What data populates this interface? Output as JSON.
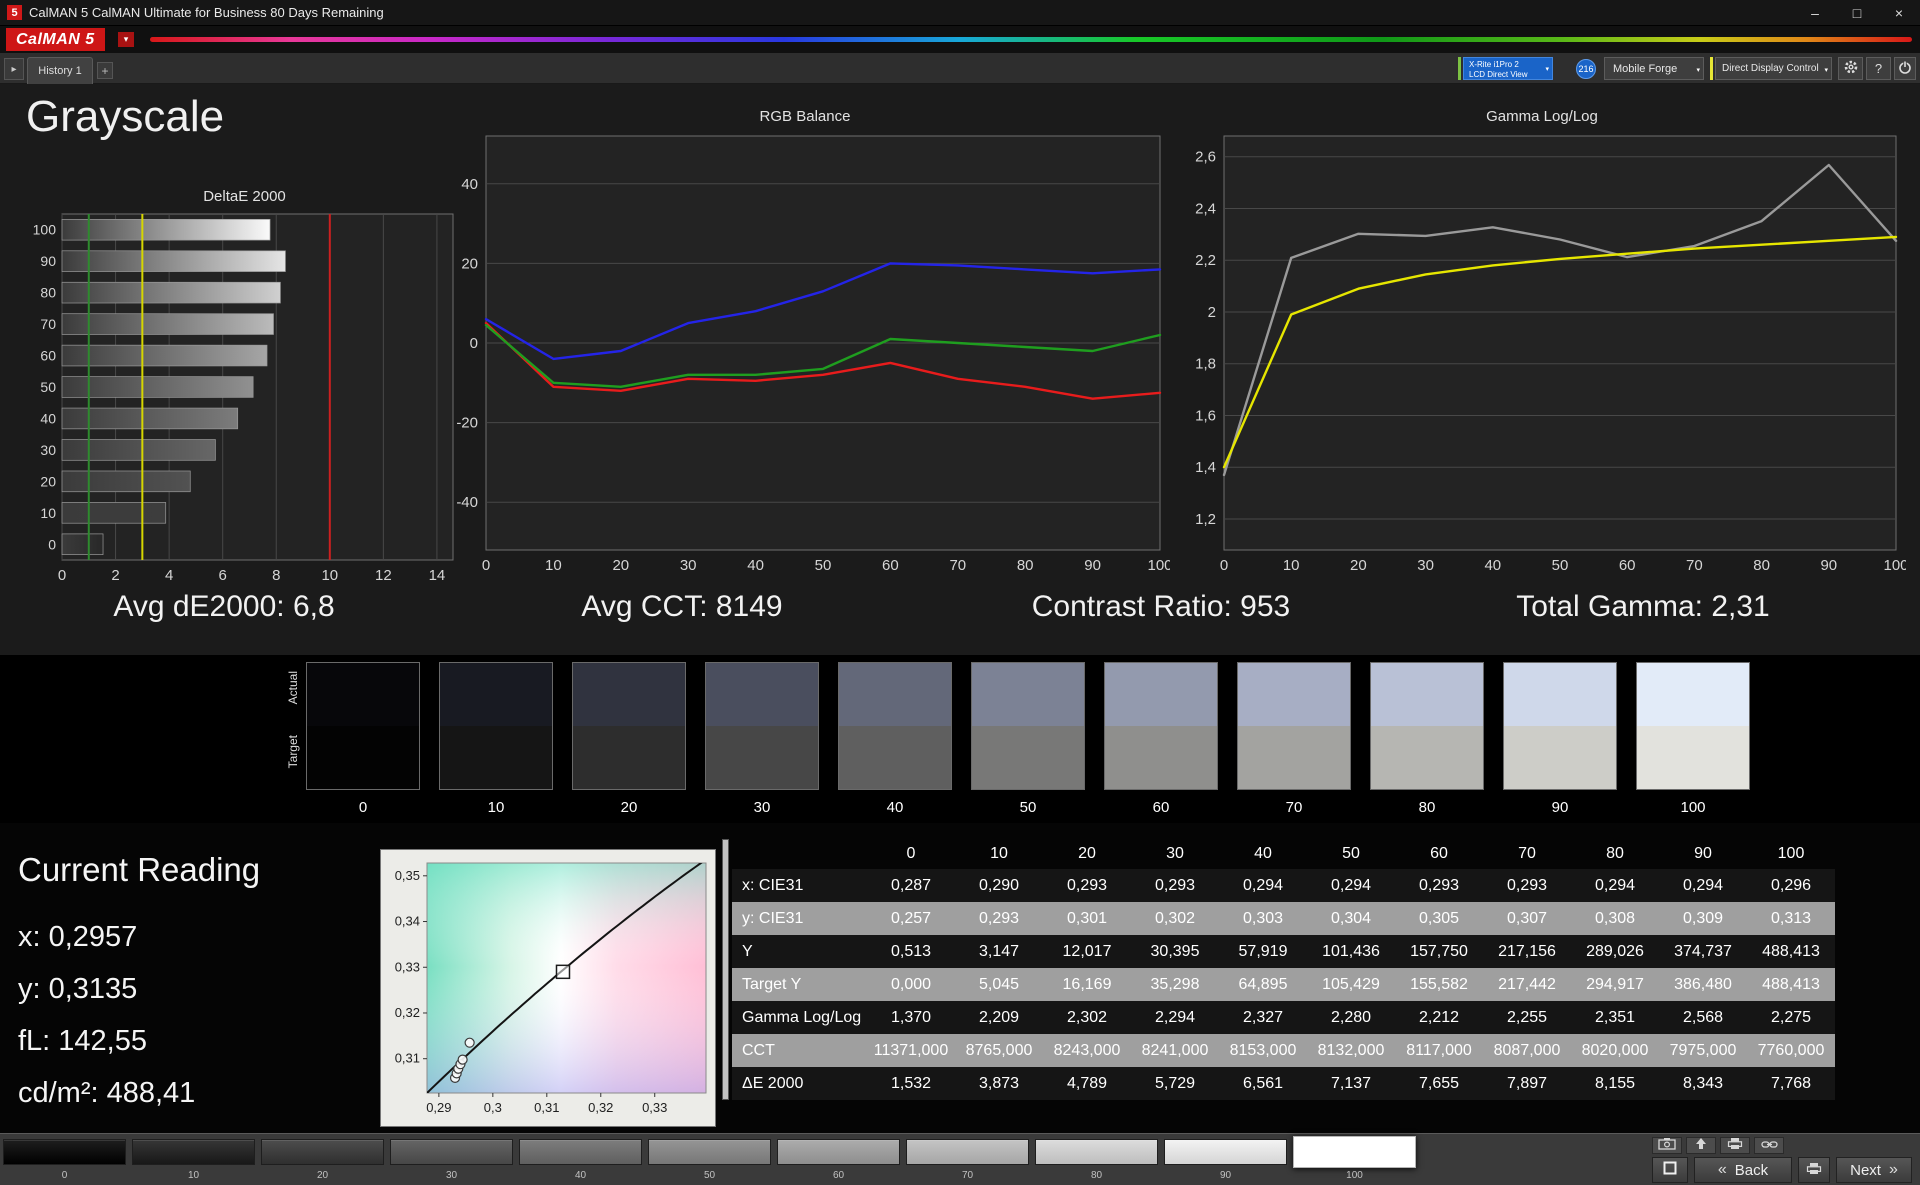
{
  "window": {
    "icon_text": "5",
    "title": "CalMAN 5 CalMAN Ultimate for Business 80 Days Remaining",
    "minimize": "–",
    "maximize": "□",
    "close": "×"
  },
  "brand": {
    "logo": "CalMAN 5"
  },
  "glyphs": {
    "caret_down": "▾",
    "tab_arrow": "▸",
    "plus": "+"
  },
  "toolbar": {
    "history_tab": "History 1",
    "meter_line1": "X-Rite i1Pro 2",
    "meter_line2": "LCD Direct View",
    "meter_badge": "216",
    "source_button": "Mobile Forge",
    "display_button": "Direct Display Control",
    "help_label": "?"
  },
  "page_title": "Grayscale",
  "stats": {
    "de2000": "Avg dE2000: 6,8",
    "cct": "Avg CCT: 8149",
    "contrast": "Contrast Ratio: 953",
    "gamma": "Total Gamma: 2,31"
  },
  "chart_data": [
    {
      "id": "deltae",
      "type": "bar",
      "title": "DeltaE 2000",
      "orientation": "horizontal",
      "categories": [
        "100",
        "90",
        "80",
        "70",
        "60",
        "50",
        "40",
        "30",
        "20",
        "10",
        "0"
      ],
      "values": [
        7.768,
        8.343,
        8.155,
        7.897,
        7.655,
        7.137,
        6.561,
        5.729,
        4.789,
        3.873,
        1.532
      ],
      "xlim": [
        0,
        14.6
      ],
      "xticks": [
        0,
        2,
        4,
        6,
        8,
        10,
        12,
        14
      ],
      "reference_lines": [
        {
          "x": 1,
          "color": "#2e8b2e",
          "name": "target-line"
        },
        {
          "x": 3,
          "color": "#d6d600",
          "name": "tolerance-line"
        },
        {
          "x": 10,
          "color": "#cc2020",
          "name": "limit-line"
        }
      ]
    },
    {
      "id": "rgb-balance",
      "type": "line",
      "title": "RGB Balance",
      "x": [
        0,
        10,
        20,
        30,
        40,
        50,
        60,
        70,
        80,
        90,
        100
      ],
      "xticks": [
        0,
        10,
        20,
        30,
        40,
        50,
        60,
        70,
        80,
        90,
        100
      ],
      "ylim": [
        -52,
        52
      ],
      "yticks": [
        {
          "v": 40,
          "label": "40"
        },
        {
          "v": 20,
          "label": "20"
        },
        {
          "v": 0,
          "label": "0"
        },
        {
          "v": -20,
          "label": "-20"
        },
        {
          "v": -40,
          "label": "-40"
        }
      ],
      "series": [
        {
          "name": "Red",
          "color": "#e81c1c",
          "values": [
            5,
            -11,
            -12,
            -9,
            -9.5,
            -8,
            -5,
            -9,
            -11,
            -14,
            -12.5
          ]
        },
        {
          "name": "Green",
          "color": "#1f9e1f",
          "values": [
            4.5,
            -10,
            -11,
            -8,
            -8,
            -6.5,
            1,
            0,
            -1,
            -2,
            2
          ]
        },
        {
          "name": "Blue",
          "color": "#2424e8",
          "values": [
            6,
            -4,
            -2,
            5,
            8,
            13,
            20,
            19.5,
            18.5,
            17.5,
            18.5
          ]
        }
      ]
    },
    {
      "id": "gamma",
      "type": "line",
      "title": "Gamma Log/Log",
      "x": [
        0,
        10,
        20,
        30,
        40,
        50,
        60,
        70,
        80,
        90,
        100
      ],
      "xticks": [
        0,
        10,
        20,
        30,
        40,
        50,
        60,
        70,
        80,
        90,
        100
      ],
      "ylim": [
        1.08,
        2.68
      ],
      "yticks": [
        {
          "v": 2.6,
          "label": "2,6"
        },
        {
          "v": 2.4,
          "label": "2,4"
        },
        {
          "v": 2.2,
          "label": "2,2"
        },
        {
          "v": 2.0,
          "label": "2"
        },
        {
          "v": 1.8,
          "label": "1,8"
        },
        {
          "v": 1.6,
          "label": "1,6"
        },
        {
          "v": 1.4,
          "label": "1,4"
        },
        {
          "v": 1.2,
          "label": "1,2"
        }
      ],
      "series": [
        {
          "name": "Measured",
          "color": "#9a9a9a",
          "values": [
            1.37,
            2.209,
            2.302,
            2.294,
            2.327,
            2.28,
            2.212,
            2.255,
            2.351,
            2.568,
            2.275
          ]
        },
        {
          "name": "Target",
          "color": "#e6e600",
          "values": [
            1.4,
            1.99,
            2.09,
            2.145,
            2.18,
            2.205,
            2.225,
            2.245,
            2.26,
            2.275,
            2.29
          ]
        }
      ]
    },
    {
      "id": "cie",
      "type": "scatter",
      "title": "CIE xy chromaticity",
      "xlim": [
        0.2878,
        0.3395
      ],
      "ylim": [
        0.3025,
        0.3528
      ],
      "xticks": [
        {
          "v": 0.29,
          "label": "0,29"
        },
        {
          "v": 0.3,
          "label": "0,3"
        },
        {
          "v": 0.31,
          "label": "0,31"
        },
        {
          "v": 0.32,
          "label": "0,32"
        },
        {
          "v": 0.33,
          "label": "0,33"
        }
      ],
      "yticks": [
        {
          "v": 0.35,
          "label": "0,35"
        },
        {
          "v": 0.34,
          "label": "0,34"
        },
        {
          "v": 0.33,
          "label": "0,33"
        },
        {
          "v": 0.32,
          "label": "0,32"
        },
        {
          "v": 0.31,
          "label": "0,31"
        }
      ],
      "target_point": {
        "x": 0.313,
        "y": 0.329
      },
      "points": [
        {
          "x": 0.293,
          "y": 0.3058
        },
        {
          "x": 0.2933,
          "y": 0.3068
        },
        {
          "x": 0.2936,
          "y": 0.3078
        },
        {
          "x": 0.294,
          "y": 0.3088
        },
        {
          "x": 0.2944,
          "y": 0.3098
        },
        {
          "x": 0.2957,
          "y": 0.3135
        }
      ]
    }
  ],
  "swatch_strip": {
    "row_labels": [
      "Actual",
      "Target"
    ],
    "steps": [
      {
        "label": "0",
        "actual": "#07070a",
        "target": "#030303"
      },
      {
        "label": "10",
        "actual": "#181a22",
        "target": "#151515"
      },
      {
        "label": "20",
        "actual": "#30333f",
        "target": "#2d2d2d"
      },
      {
        "label": "30",
        "actual": "#4a4e5e",
        "target": "#474747"
      },
      {
        "label": "40",
        "actual": "#636879",
        "target": "#5f5f5f"
      },
      {
        "label": "50",
        "actual": "#7c8295",
        "target": "#787877"
      },
      {
        "label": "60",
        "actual": "#939aae",
        "target": "#8f8f8d"
      },
      {
        "label": "70",
        "actual": "#a7aec4",
        "target": "#a3a3a0"
      },
      {
        "label": "80",
        "actual": "#b9c1d6",
        "target": "#b6b6b2"
      },
      {
        "label": "90",
        "actual": "#cfd8ea",
        "target": "#cdcdc8"
      },
      {
        "label": "100",
        "actual": "#e2ebf8",
        "target": "#e2e2dd"
      }
    ]
  },
  "current_reading": {
    "title": "Current Reading",
    "x": "x: 0,2957",
    "y": "y: 0,3135",
    "fl": "fL: 142,55",
    "cdm2": "cd/m²: 488,41"
  },
  "table": {
    "columns": [
      "0",
      "10",
      "20",
      "30",
      "40",
      "50",
      "60",
      "70",
      "80",
      "90",
      "100"
    ],
    "rows": [
      {
        "label": "x: CIE31",
        "values": [
          "0,287",
          "0,290",
          "0,293",
          "0,293",
          "0,294",
          "0,294",
          "0,293",
          "0,293",
          "0,294",
          "0,294",
          "0,296"
        ]
      },
      {
        "label": "y: CIE31",
        "values": [
          "0,257",
          "0,293",
          "0,301",
          "0,302",
          "0,303",
          "0,304",
          "0,305",
          "0,307",
          "0,308",
          "0,309",
          "0,313"
        ]
      },
      {
        "label": "Y",
        "values": [
          "0,513",
          "3,147",
          "12,017",
          "30,395",
          "57,919",
          "101,436",
          "157,750",
          "217,156",
          "289,026",
          "374,737",
          "488,413"
        ]
      },
      {
        "label": "Target Y",
        "values": [
          "0,000",
          "5,045",
          "16,169",
          "35,298",
          "64,895",
          "105,429",
          "155,582",
          "217,442",
          "294,917",
          "386,480",
          "488,413"
        ]
      },
      {
        "label": "Gamma Log/Log",
        "values": [
          "1,370",
          "2,209",
          "2,302",
          "2,294",
          "2,327",
          "2,280",
          "2,212",
          "2,255",
          "2,351",
          "2,568",
          "2,275"
        ]
      },
      {
        "label": "CCT",
        "values": [
          "11371,000",
          "8765,000",
          "8243,000",
          "8241,000",
          "8153,000",
          "8132,000",
          "8117,000",
          "8087,000",
          "8020,000",
          "7975,000",
          "7760,000"
        ]
      },
      {
        "label": "ΔE 2000",
        "values": [
          "1,532",
          "3,873",
          "4,789",
          "5,729",
          "6,561",
          "7,137",
          "7,655",
          "7,897",
          "8,155",
          "8,343",
          "7,768"
        ]
      }
    ]
  },
  "bottom_bar": {
    "steps": [
      "0",
      "10",
      "20",
      "30",
      "40",
      "50",
      "60",
      "70",
      "80",
      "90",
      "100"
    ],
    "selected_step": "100",
    "back": "Back",
    "next": "Next",
    "back_symbol": "«",
    "next_symbol": "»"
  }
}
